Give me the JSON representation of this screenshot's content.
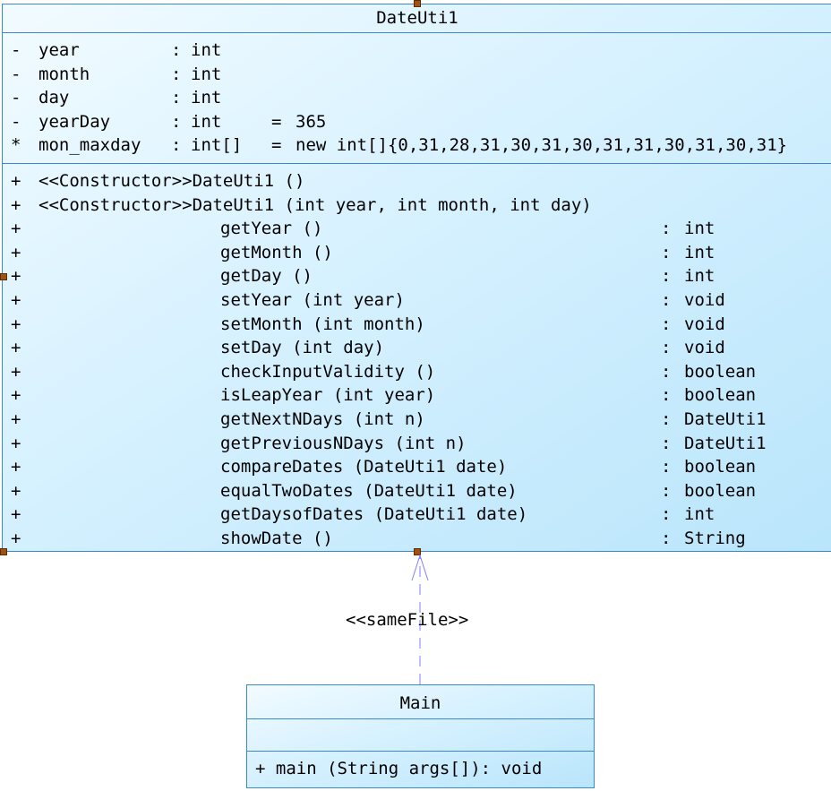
{
  "dateutil": {
    "name": "DateUti1",
    "attributes": [
      {
        "vis": "-",
        "name": "year",
        "colon": ":",
        "type": "int",
        "eq": "",
        "init": ""
      },
      {
        "vis": "-",
        "name": "month",
        "colon": ":",
        "type": "int",
        "eq": "",
        "init": ""
      },
      {
        "vis": "-",
        "name": "day",
        "colon": ":",
        "type": "int",
        "eq": "",
        "init": ""
      },
      {
        "vis": "-",
        "name": "yearDay",
        "colon": ":",
        "type": "int",
        "eq": "=",
        "init": "365"
      },
      {
        "vis": "*",
        "name": "mon_maxday",
        "colon": ":",
        "type": "int[]",
        "eq": "=",
        "init": "new int[]{0,31,28,31,30,31,30,31,31,30,31,30,31}"
      }
    ],
    "constructors": [
      {
        "vis": "+",
        "text": "<<Constructor>>DateUti1 ()"
      },
      {
        "vis": "+",
        "text": "<<Constructor>>DateUti1 (int year, int month, int day)"
      }
    ],
    "operations": [
      {
        "vis": "+",
        "name": "getYear ()",
        "colon": ":",
        "type": "int"
      },
      {
        "vis": "+",
        "name": "getMonth ()",
        "colon": ":",
        "type": "int"
      },
      {
        "vis": "+",
        "name": "getDay ()",
        "colon": ":",
        "type": "int"
      },
      {
        "vis": "+",
        "name": "setYear (int year)",
        "colon": ":",
        "type": "void"
      },
      {
        "vis": "+",
        "name": "setMonth (int month)",
        "colon": ":",
        "type": "void"
      },
      {
        "vis": "+",
        "name": "setDay (int day)",
        "colon": ":",
        "type": "void"
      },
      {
        "vis": "+",
        "name": "checkInputValidity ()",
        "colon": ":",
        "type": "boolean"
      },
      {
        "vis": "+",
        "name": "isLeapYear (int year)",
        "colon": ":",
        "type": "boolean"
      },
      {
        "vis": "+",
        "name": "getNextNDays (int n)",
        "colon": ":",
        "type": "DateUti1"
      },
      {
        "vis": "+",
        "name": "getPreviousNDays (int n)",
        "colon": ":",
        "type": "DateUti1"
      },
      {
        "vis": "+",
        "name": "compareDates (DateUti1 date)",
        "colon": ":",
        "type": "boolean"
      },
      {
        "vis": "+",
        "name": "equalTwoDates (DateUti1 date)",
        "colon": ":",
        "type": "boolean"
      },
      {
        "vis": "+",
        "name": "getDaysofDates (DateUti1 date)",
        "colon": ":",
        "type": "int"
      },
      {
        "vis": "+",
        "name": "showDate ()",
        "colon": ":",
        "type": "String"
      }
    ]
  },
  "main": {
    "name": "Main",
    "operations": [
      {
        "text": "+ main (String args[]): void"
      }
    ]
  },
  "relation": {
    "stereotype": "<<sameFile>>"
  },
  "colors": {
    "class_border": "#3d88c9",
    "class_fill_start": "#f2fbff",
    "class_fill_end": "#b9e5fb",
    "dependency_line": "#7f7fff",
    "selection_handle": "#a0520f"
  }
}
